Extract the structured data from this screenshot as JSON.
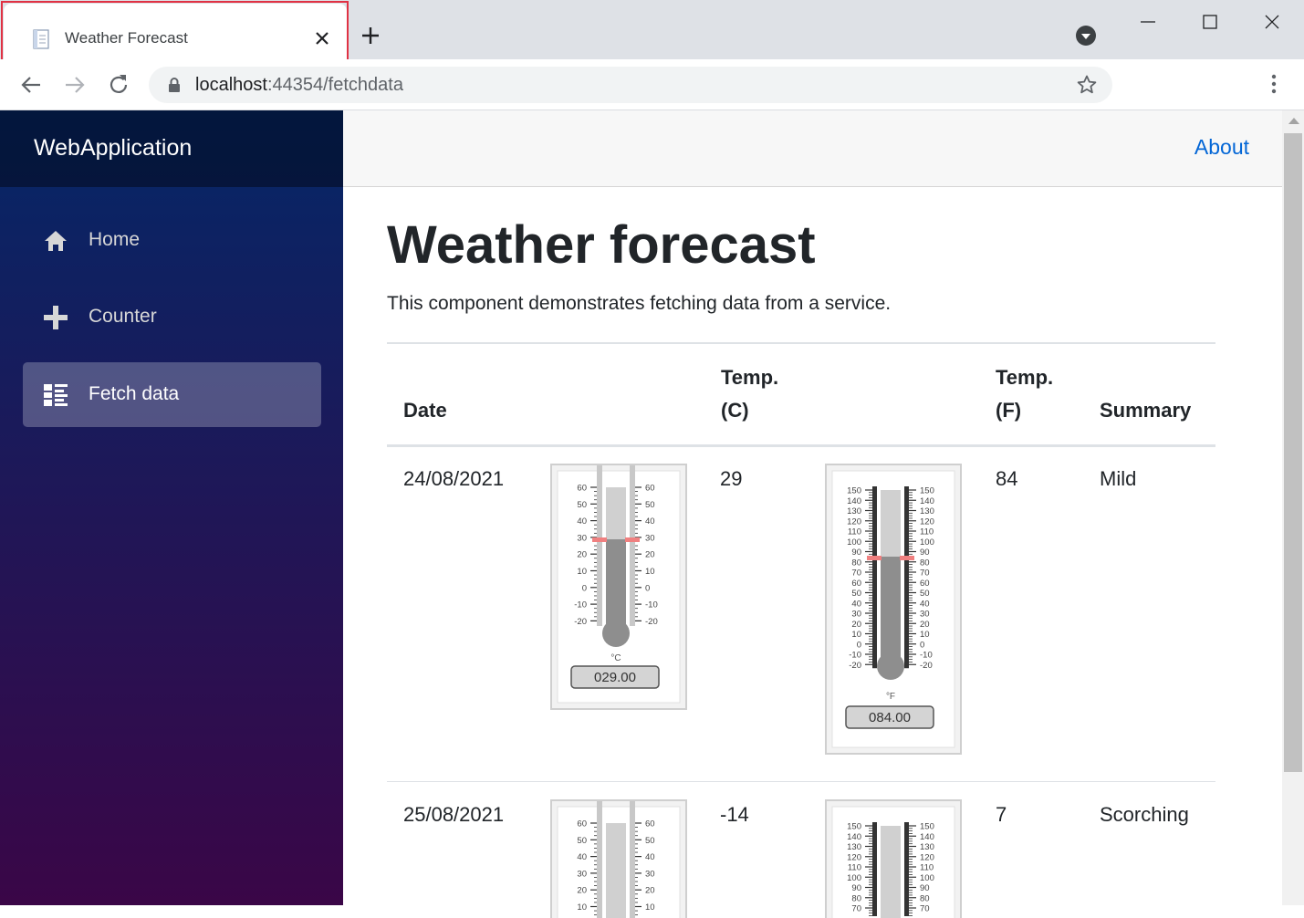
{
  "browser": {
    "tab_title": "Weather Forecast",
    "url_host": "localhost",
    "url_rest": ":44354/fetchdata"
  },
  "app": {
    "brand": "WebApplication",
    "about": "About",
    "nav": [
      {
        "label": "Home",
        "icon": "home-icon"
      },
      {
        "label": "Counter",
        "icon": "plus-icon"
      },
      {
        "label": "Fetch data",
        "icon": "list-icon",
        "active": true
      }
    ]
  },
  "page": {
    "title": "Weather forecast",
    "description": "This component demonstrates fetching data from a service.",
    "columns": {
      "date": "Date",
      "temp_c_line1": "Temp.",
      "temp_c_line2": "(C)",
      "temp_f_line1": "Temp.",
      "temp_f_line2": "(F)",
      "summary": "Summary"
    },
    "rows": [
      {
        "date": "24/08/2021",
        "temp_c": "29",
        "temp_f": "84",
        "summary": "Mild",
        "gauge_c": "029.00",
        "gauge_f": "084.00"
      },
      {
        "date": "25/08/2021",
        "temp_c": "-14",
        "temp_f": "7",
        "summary": "Scorching"
      }
    ],
    "celsius_unit": "°C",
    "fahrenheit_unit": "°F",
    "celsius_scale": [
      "60",
      "50",
      "40",
      "30",
      "20",
      "10",
      "0",
      "-10",
      "-20"
    ],
    "fahrenheit_scale": [
      "150",
      "140",
      "130",
      "120",
      "110",
      "100",
      "90",
      "80",
      "70",
      "60",
      "50",
      "40",
      "30",
      "20",
      "10",
      "0",
      "-10",
      "-20"
    ]
  },
  "colors": {
    "sidebar_top": "#052767",
    "sidebar_bottom": "#3a0647",
    "link": "#0366d6",
    "tab_highlight": "#e03244",
    "thermo_marker": "#f08080"
  }
}
